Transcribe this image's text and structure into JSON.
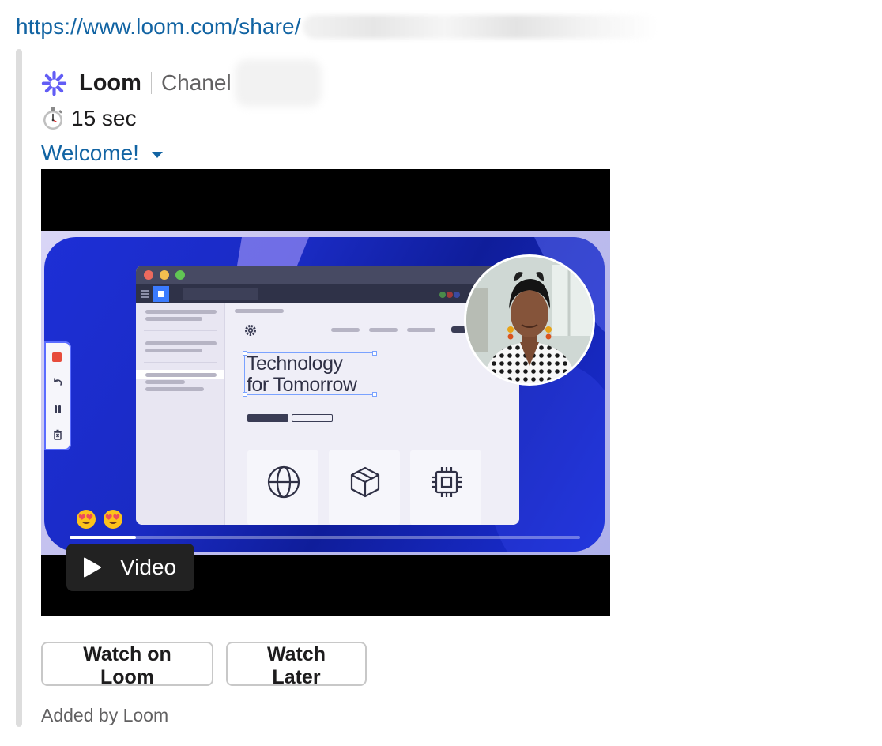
{
  "message": {
    "url": "https://www.loom.com/share/"
  },
  "attachment": {
    "app_name": "Loom",
    "author": "Chanel",
    "duration": "15 sec",
    "title": "Welcome!",
    "footer": "Added by Loom",
    "accent_color": "#625df5",
    "link_color": "#1264a3"
  },
  "video": {
    "headline_line1": "Technology",
    "headline_line2": "for Tomorrow",
    "play_label": "Video",
    "progress": 0.13
  },
  "actions": {
    "watch_on_loom": "Watch on Loom",
    "watch_later": "Watch Later"
  },
  "icons": {
    "logo": "loom-logo-icon",
    "timer": "stopwatch-icon",
    "caret": "caret-down-icon",
    "play": "play-icon"
  }
}
